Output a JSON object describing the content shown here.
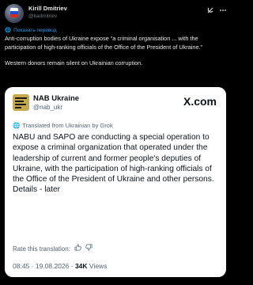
{
  "author": {
    "display_name": "Kirill Dmitriev",
    "handle": "@kadmitriev"
  },
  "header_icons": [
    "grok-icon",
    "more-icon"
  ],
  "translate_link": "Показать перевод",
  "post": {
    "paragraph1": "Anti-corruption bodies of Ukraine expose “a criminal organisation ... with the participation of high-ranking officials of the Office of the President of Ukraine.”",
    "paragraph2": "Western donors remain silent on Ukrainian corruption."
  },
  "card": {
    "name": "NAB Ukraine",
    "handle": "@nab_ukr",
    "platform_logo": "X.com",
    "translated_by": "Translated from Ukrainian by Grok",
    "text": "NABU and SAPO are conducting a special operation to expose a criminal organization that operated under the leadership of current and former people's deputies of Ukraine, with the participation of high-ranking officials of the Office of the President of Ukraine and other persons.",
    "text_tail": "Details - later",
    "rate_label": "Rate this translation:",
    "time": "08:45",
    "date": "19.08.2026",
    "views_count": "34K",
    "views_label": "Views"
  },
  "colors": {
    "background": "#000000",
    "link": "#1d9bf0",
    "card_bg": "#ffffff",
    "muted": "#536471"
  }
}
